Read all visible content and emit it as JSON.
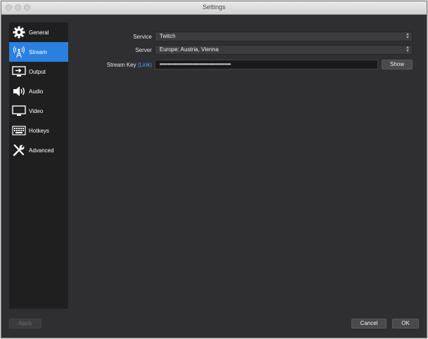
{
  "window": {
    "title": "Settings"
  },
  "sidebar": {
    "items": [
      {
        "label": "General",
        "icon": "gear-icon",
        "active": false
      },
      {
        "label": "Stream",
        "icon": "broadcast-antenna-icon",
        "active": true
      },
      {
        "label": "Output",
        "icon": "output-monitor-icon",
        "active": false
      },
      {
        "label": "Audio",
        "icon": "speaker-icon",
        "active": false
      },
      {
        "label": "Video",
        "icon": "monitor-icon",
        "active": false
      },
      {
        "label": "Hotkeys",
        "icon": "keyboard-icon",
        "active": false
      },
      {
        "label": "Advanced",
        "icon": "wrench-screwdriver-icon",
        "active": false
      }
    ]
  },
  "stream": {
    "service_label": "Service",
    "service_value": "Twitch",
    "server_label": "Server",
    "server_value": "Europe: Austria, Vienna",
    "key_label": "Stream Key",
    "key_link": "(Link)",
    "key_value": "••••••••••••••••••••••••••••••••••••••••••••",
    "show_label": "Show"
  },
  "footer": {
    "apply_label": "Apply",
    "cancel_label": "Cancel",
    "ok_label": "OK"
  },
  "colors": {
    "accent": "#2a80e0",
    "link": "#4aa0ff",
    "panel": "#2f2e30",
    "sidebar": "#1f1f20"
  }
}
